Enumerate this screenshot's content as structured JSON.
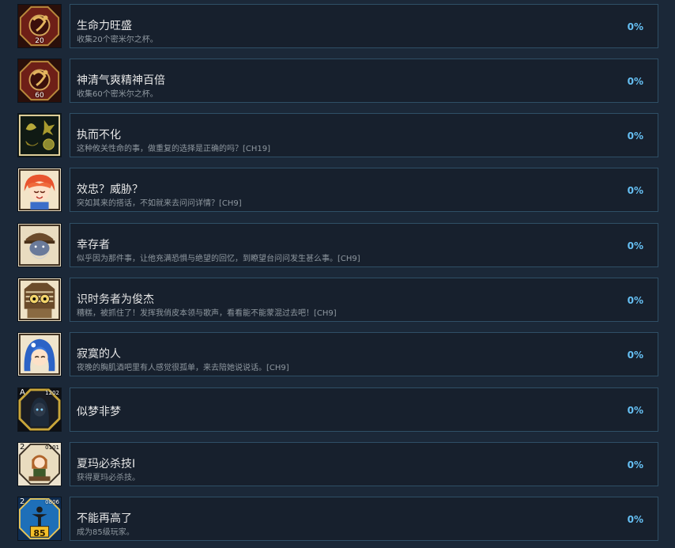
{
  "achievements": [
    {
      "title": "生命力旺盛",
      "desc": "收集20个密米尔之杯。",
      "percent": "0%",
      "badge": "20"
    },
    {
      "title": "神清气爽精神百倍",
      "desc": "收集60个密米尔之杯。",
      "percent": "0%",
      "badge": "60"
    },
    {
      "title": "执而不化",
      "desc": "这种攸关性命的事，做重复的选择是正确的吗？[CH19]",
      "percent": "0%"
    },
    {
      "title": "效忠？威胁？",
      "desc": "突如其来的搭话，不如就来去问问详情？[CH9]",
      "percent": "0%"
    },
    {
      "title": "幸存者",
      "desc": "似乎因为那件事，让他充满恐惧与绝望的回忆，到瞭望台问问发生甚么事。[CH9]",
      "percent": "0%"
    },
    {
      "title": "识时务者为俊杰",
      "desc": "糟糕，被抓住了！发挥我俏皮本领与歌声，看看能不能蒙混过去吧！[CH9]",
      "percent": "0%"
    },
    {
      "title": "寂寞的人",
      "desc": "夜晚的胸肌酒吧里有人感觉很孤单，来去陪她说说话。[CH9]",
      "percent": "0%"
    },
    {
      "title": "似梦非梦",
      "percent": "0%",
      "corner_left": "A",
      "corner_right": "1202"
    },
    {
      "title": "夏玛必杀技I",
      "desc": "获得夏玛必杀技。",
      "percent": "0%",
      "corner_left": "2",
      "corner_right": "0101"
    },
    {
      "title": "不能再高了",
      "desc": "成为85级玩家。",
      "percent": "0%",
      "corner_left": "2",
      "corner_right": "0806",
      "badge": "85"
    }
  ],
  "colors": {
    "background": "#1b2838",
    "panel": "#17202d",
    "border": "#2f4f66",
    "percent": "#66c0f4",
    "title": "#e6e6e6",
    "desc": "#8f98a0"
  }
}
